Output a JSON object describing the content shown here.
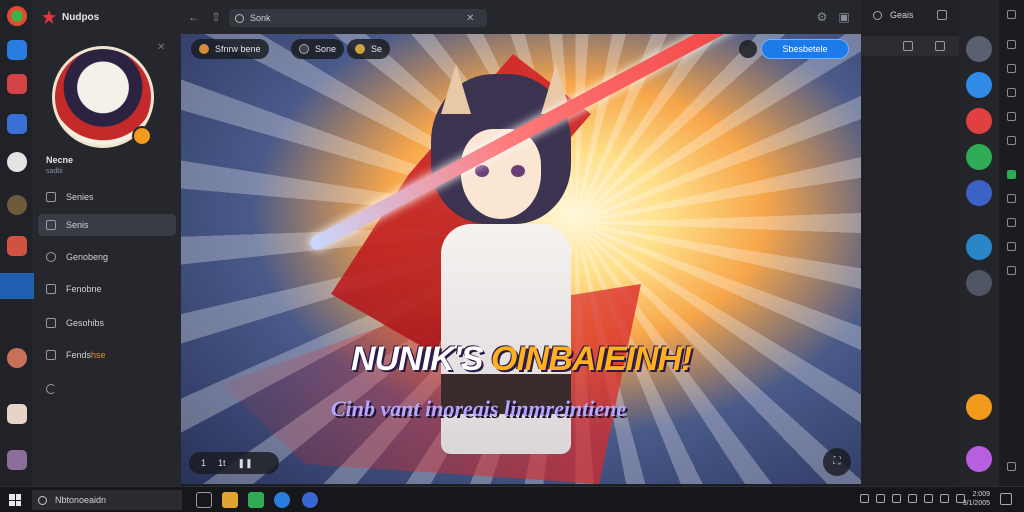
{
  "brand": {
    "name": "Nudpos"
  },
  "user": {
    "name": "Necne",
    "sub": "sadbi"
  },
  "sidebar": {
    "items": [
      {
        "label": "Senies"
      },
      {
        "label": "Senis"
      },
      {
        "label": "Genobeng"
      },
      {
        "label": "Fenobne"
      },
      {
        "label": "Gesohibs"
      },
      {
        "label": "Fends",
        "extra": "hse"
      }
    ]
  },
  "search": {
    "value": "Sonk"
  },
  "hero": {
    "pills": [
      {
        "label": "Sfnrw bene"
      },
      {
        "label": "Sone"
      },
      {
        "label": "Se"
      }
    ],
    "cta_label": "Sbesbetele",
    "headline_part1": "NUNIK'S ",
    "headline_part2": "OINBAIEINH!",
    "subline": "Cinb vant inoreais linmreintiene",
    "controls": {
      "prev": "1",
      "count": "1t"
    }
  },
  "rpanel": {
    "title": "Geais"
  },
  "taskbar": {
    "search_text": "Nbtonoeaidn",
    "time": "2:009",
    "date": "3/1/2005"
  },
  "colors": {
    "accent": "#1c7be8",
    "brand": "#e2343d",
    "cape_red": "#e1262a",
    "headline_gold": "#ffb020"
  }
}
